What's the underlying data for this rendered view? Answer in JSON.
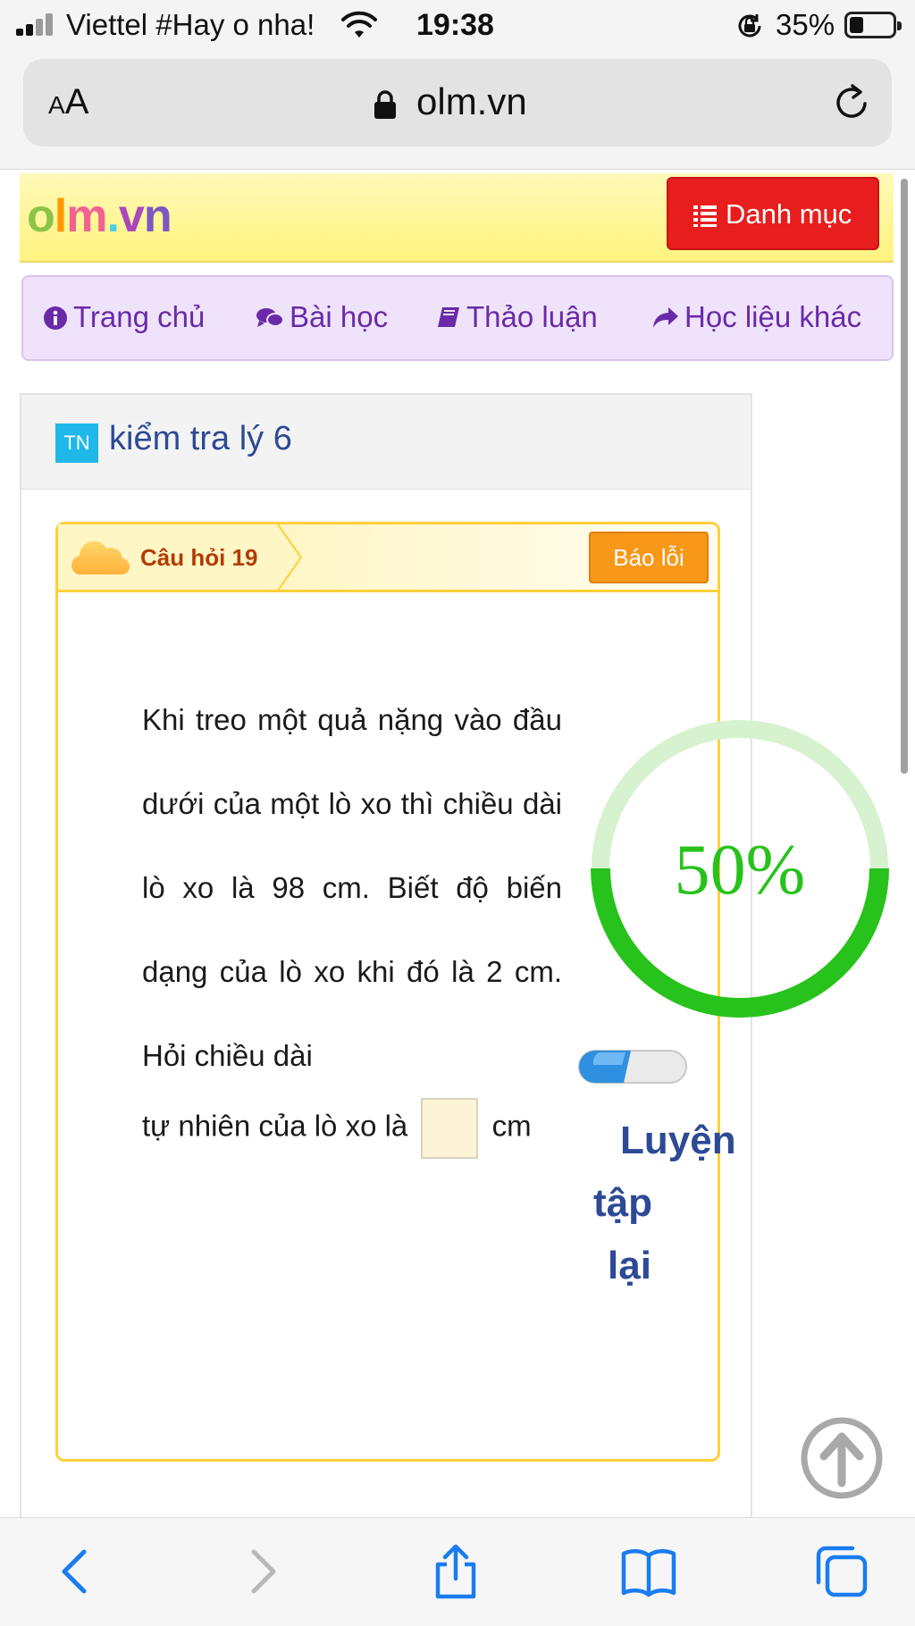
{
  "status_bar": {
    "carrier": "Viettel #Hay o nha!",
    "time": "19:38",
    "battery_percent": "35%",
    "battery_level": 0.35
  },
  "browser": {
    "text_size_button": "AA",
    "url": "olm.vn"
  },
  "site": {
    "logo_text": "olm.vn",
    "menu_button": "Danh mục",
    "nav": [
      {
        "label": "Trang chủ",
        "icon": "info-icon"
      },
      {
        "label": "Bài học",
        "icon": "chat-icon"
      },
      {
        "label": "Thảo luận",
        "icon": "book-icon"
      },
      {
        "label": "Học liệu khác",
        "icon": "share-icon"
      }
    ]
  },
  "quiz": {
    "badge": "TN",
    "title": "kiểm tra lý 6",
    "question_label": "Câu hỏi 19",
    "report_button": "Báo lỗi",
    "question_text": "Khi treo một quả nặng vào đầu dưới của một lò xo thì chiều dài lò xo là 98 cm. Biết độ biến dạng của lò xo khi đó là 2 cm. Hỏi chiều dài",
    "answer_prefix": "tự nhiên của lò xo là",
    "answer_value": "",
    "answer_unit": "cm",
    "progress_text": "50%",
    "progress_value": 0.5,
    "retry_label": [
      "Luyện",
      "tập",
      "lại"
    ]
  },
  "colors": {
    "accent_green": "#27c21b",
    "ring_track": "#d6f2cf",
    "menu_red": "#e81e1e",
    "title_blue": "#2d4a96",
    "nav_purple": "#6a2aa8",
    "ios_blue": "#1a7cf0"
  }
}
